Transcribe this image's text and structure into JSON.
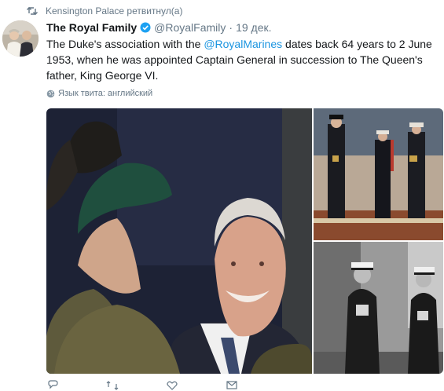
{
  "retweet": {
    "text": "Kensington Palace ретвитнул(а)"
  },
  "tweet": {
    "author_name": "The Royal Family",
    "handle": "@RoyalFamily",
    "separator": "·",
    "date": "19 дек.",
    "text_before": "The Duke's association with the ",
    "mention": "@RoyalMarines",
    "text_after": " dates back 64 years to 2 June 1953, when he was appointed Captain General in succession to The Queen's father, King George VI."
  },
  "language_note": "Язык твита: английский",
  "icons": [
    "retweet-icon",
    "verified-badge-icon",
    "globe-icon",
    "reply-icon",
    "retweet-action-icon",
    "like-icon",
    "message-icon"
  ],
  "colors": {
    "link": "#1b95e0",
    "verified": "#1da1f2",
    "secondary_text": "#657786"
  }
}
